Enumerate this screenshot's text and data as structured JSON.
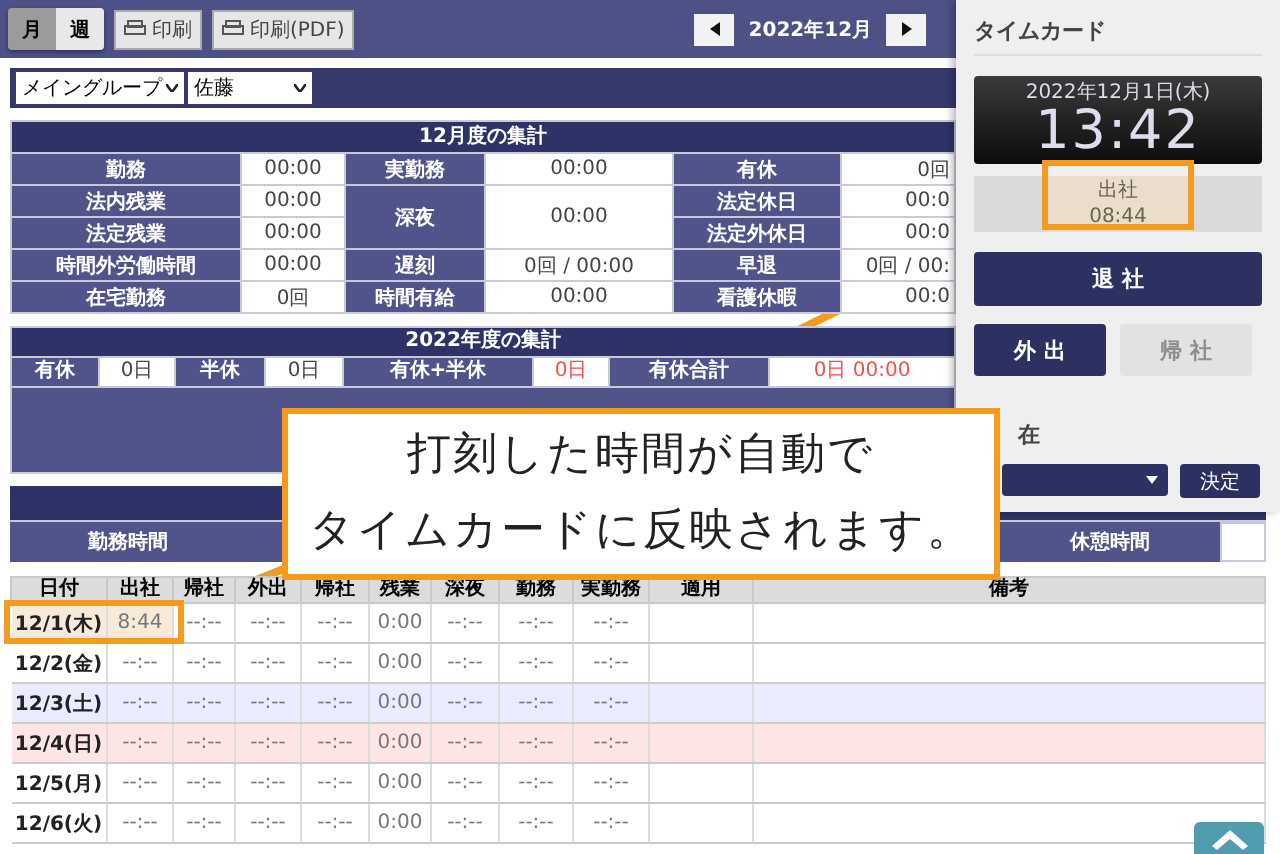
{
  "toolbar": {
    "view_tabs": [
      {
        "label": "月",
        "selected": true
      },
      {
        "label": "週",
        "selected": false
      }
    ],
    "buttons": [
      "印刷",
      "印刷(PDF)"
    ],
    "month": "2022年12月"
  },
  "filters": {
    "group": "メイングループ",
    "person": "佐藤"
  },
  "monthly_summary": {
    "title": "12月度の集計",
    "groups": [
      {
        "items": [
          {
            "label": "勤務",
            "value": "00:00",
            "kind": "normal"
          },
          {
            "label": "法内残業",
            "value": "00:00",
            "kind": "normal"
          },
          {
            "label": "法定残業",
            "value": "00:00",
            "kind": "normal"
          },
          {
            "label": "時間外労働時間",
            "value": "00:00",
            "kind": "normal"
          },
          {
            "label": "在宅勤務",
            "value": "0回",
            "kind": "normal"
          }
        ]
      },
      {
        "items": [
          {
            "label": "実勤務",
            "value": "00:00",
            "kind": "normal"
          },
          {
            "label": "深夜",
            "value": "00:00",
            "kind": "tall"
          },
          {
            "label": "遅刻",
            "value": "0回 / 00:00",
            "kind": "normal"
          },
          {
            "label": "時間有給",
            "value": "00:00",
            "kind": "normal"
          }
        ]
      },
      {
        "items": [
          {
            "label": "有休",
            "value": "0回",
            "kind": "normal"
          },
          {
            "label": "法定休日",
            "value": "00:0",
            "kind": "normal"
          },
          {
            "label": "法定外休日",
            "value": "00:0",
            "kind": "normal"
          },
          {
            "label": "早退",
            "value": "0回 / 00:",
            "kind": "normal"
          },
          {
            "label": "看護休暇",
            "value": "00:0",
            "kind": "normal"
          }
        ]
      }
    ]
  },
  "yearly_summary": {
    "title": "2022年度の集計",
    "cells": [
      {
        "kind": "label",
        "text": "有休"
      },
      {
        "kind": "value",
        "text": "0日",
        "alert": false
      },
      {
        "kind": "label",
        "text": "半休"
      },
      {
        "kind": "value",
        "text": "0日",
        "alert": false
      },
      {
        "kind": "label",
        "text": "有休+半休"
      },
      {
        "kind": "value",
        "text": "0日",
        "alert": true
      },
      {
        "kind": "label",
        "text": "有休合計"
      },
      {
        "kind": "value",
        "text": "0日 00:00",
        "alert": true
      }
    ]
  },
  "hours_table": {
    "labels": [
      "勤務時間",
      "休憩時間"
    ]
  },
  "daily": {
    "columns": [
      "日付",
      "出社",
      "帰社",
      "外出",
      "帰社",
      "残業",
      "深夜",
      "勤務",
      "実勤務",
      "適用",
      "備考"
    ],
    "rows": [
      {
        "kind": "weekday",
        "highlighted": true,
        "cells": [
          "12/1(木)",
          "8:44",
          "--:--",
          "--:--",
          "--:--",
          "0:00",
          "--:--",
          "--:--",
          "--:--"
        ]
      },
      {
        "kind": "weekday",
        "highlighted": false,
        "cells": [
          "12/2(金)",
          "--:--",
          "--:--",
          "--:--",
          "--:--",
          "0:00",
          "--:--",
          "--:--",
          "--:--"
        ]
      },
      {
        "kind": "saturday",
        "highlighted": false,
        "cells": [
          "12/3(土)",
          "--:--",
          "--:--",
          "--:--",
          "--:--",
          "0:00",
          "--:--",
          "--:--",
          "--:--"
        ]
      },
      {
        "kind": "sunday",
        "highlighted": false,
        "cells": [
          "12/4(日)",
          "--:--",
          "--:--",
          "--:--",
          "--:--",
          "0:00",
          "--:--",
          "--:--",
          "--:--"
        ]
      },
      {
        "kind": "weekday",
        "highlighted": false,
        "cells": [
          "12/5(月)",
          "--:--",
          "--:--",
          "--:--",
          "--:--",
          "0:00",
          "--:--",
          "--:--",
          "--:--"
        ]
      },
      {
        "kind": "weekday",
        "highlighted": false,
        "cells": [
          "12/6(火)",
          "--:--",
          "--:--",
          "--:--",
          "--:--",
          "0:00",
          "--:--",
          "--:--",
          "--:--"
        ]
      }
    ]
  },
  "timecard": {
    "title": "タイムカード",
    "date": "2022年12月1日(木)",
    "time": "13:42",
    "status_label": "出社",
    "status_time": "08:44",
    "buttons": [
      {
        "label": "退 社",
        "kind": "wide",
        "disabled": false
      },
      {
        "label": "外 出",
        "kind": "half",
        "disabled": false
      },
      {
        "label": "帰 社",
        "kind": "half",
        "disabled": true
      }
    ],
    "section": "在",
    "confirm": "決定"
  },
  "callout": {
    "lines": [
      "打刻した時間が自動で",
      "タイムカードに反映されます。"
    ]
  }
}
